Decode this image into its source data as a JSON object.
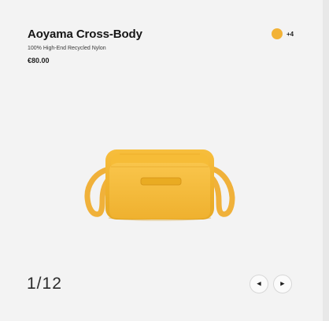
{
  "product": {
    "title": "Aoyama Cross-Body",
    "material": "100% High-End Recycled Nylon",
    "price": "€80.00",
    "color_accent": "#f2b236",
    "extra_colors_label": "+4"
  },
  "gallery": {
    "counter": "1/12"
  },
  "icons": {
    "prev": "chevron-left-icon",
    "next": "chevron-right-icon"
  }
}
